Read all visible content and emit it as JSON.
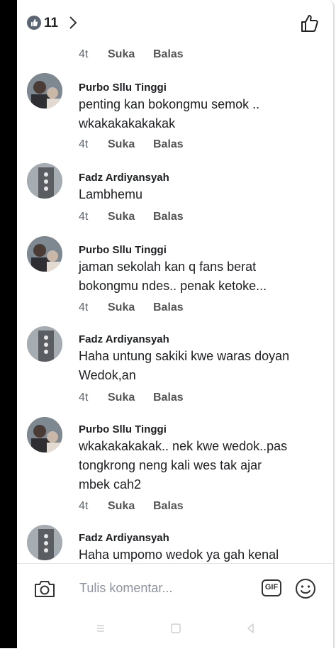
{
  "header": {
    "like_count": "11",
    "like_icon": "thumbs-up-icon",
    "chevron_icon": "chevron-right-icon"
  },
  "first_meta": {
    "time": "4t",
    "like": "Suka",
    "reply": "Balas"
  },
  "comments": [
    {
      "author": "Purbo Sllu Tinggi",
      "lines": [
        "penting kan bokongmu semok ..",
        "wkakakakakakak"
      ],
      "time": "4t",
      "like": "Suka",
      "reply": "Balas"
    },
    {
      "author": "Fadz Ardiyansyah",
      "lines": [
        "Lambhemu"
      ],
      "time": "4t",
      "like": "Suka",
      "reply": "Balas"
    },
    {
      "author": "Purbo Sllu Tinggi",
      "lines": [
        "jaman sekolah kan q fans berat",
        "bokongmu ndes.. penak ketoke..."
      ],
      "time": "4t",
      "like": "Suka",
      "reply": "Balas"
    },
    {
      "author": "Fadz Ardiyansyah",
      "lines": [
        "Haha untung sakiki kwe waras doyan",
        "Wedok,an"
      ],
      "time": "4t",
      "like": "Suka",
      "reply": "Balas"
    },
    {
      "author": "Purbo Sllu Tinggi",
      "lines": [
        "wkakakakakak.. nek kwe wedok..pas",
        "tongkrong neng kali wes tak ajar",
        "mbek cah2"
      ],
      "time": "4t",
      "like": "Suka",
      "reply": "Balas"
    },
    {
      "author": "Fadz Ardiyansyah",
      "lines": [
        "Haha umpomo wedok ya gah kenal"
      ]
    }
  ],
  "composer": {
    "placeholder": "Tulis komentar...",
    "gif_label": "GIF"
  },
  "colors": {
    "text": "#1c1e21",
    "meta": "#606770",
    "placeholder": "#8d949e",
    "badge": "#5b6674"
  }
}
